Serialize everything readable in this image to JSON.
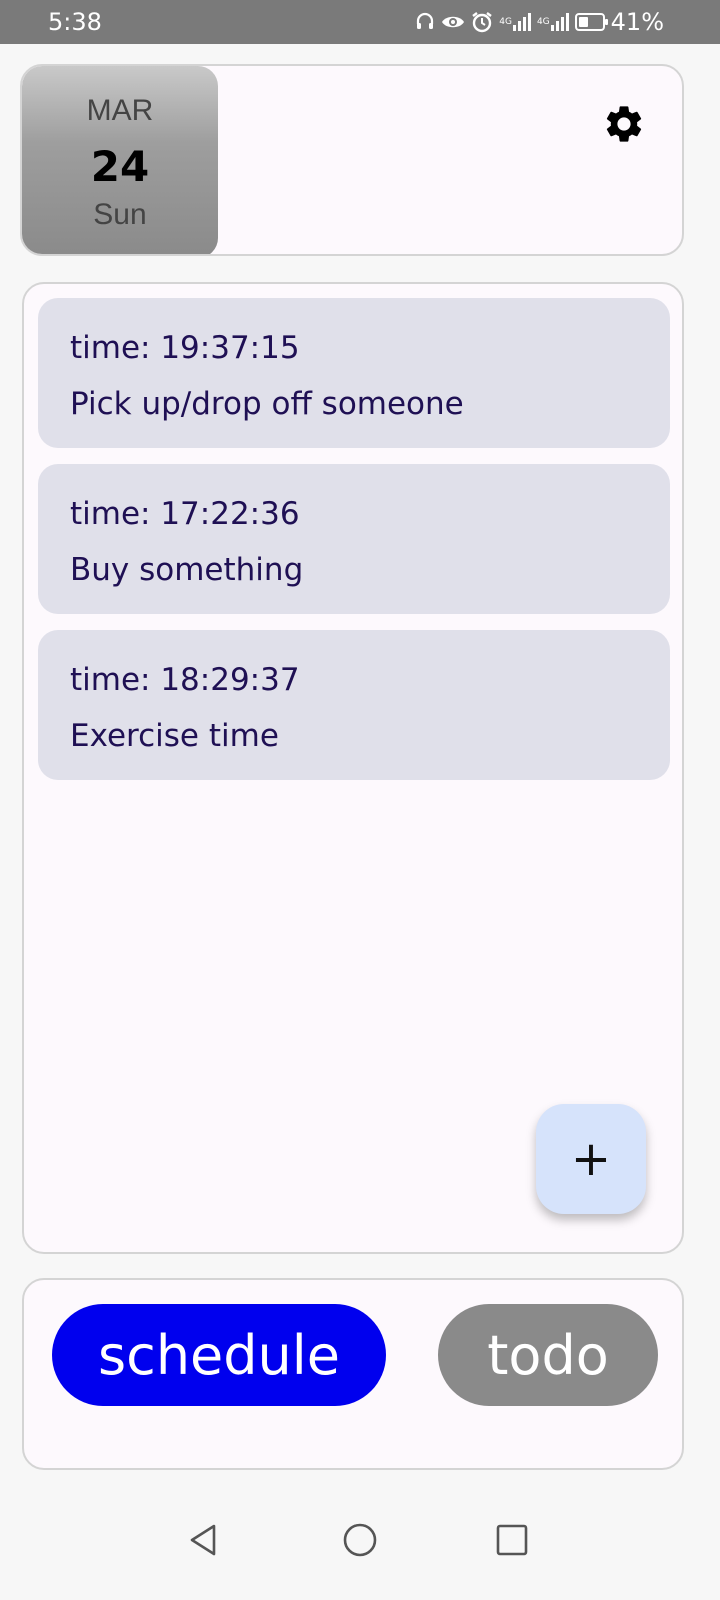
{
  "status_bar": {
    "time": "5:38",
    "icons": [
      "headphones-icon",
      "eye-icon",
      "alarm-icon",
      "signal-4g-icon",
      "signal-4g-icon",
      "battery-icon"
    ],
    "signal_label": "4G",
    "battery_percent": "41%",
    "battery_level": 0.41
  },
  "header": {
    "month": "MAR",
    "day": "24",
    "weekday": "Sun",
    "settings_icon": "gear-icon"
  },
  "schedule_items": [
    {
      "time": "time: 19:37:15",
      "title": "Pick up/drop off someone"
    },
    {
      "time": "time: 17:22:36",
      "title": "Buy something"
    },
    {
      "time": "time: 18:29:37",
      "title": "Exercise time"
    }
  ],
  "fab": {
    "label": "+",
    "icon": "plus-icon"
  },
  "tabs": {
    "schedule_label": "schedule",
    "todo_label": "todo",
    "active": "schedule",
    "active_color": "#0000ee",
    "inactive_color": "#8a8a8a"
  },
  "nav": {
    "icons": [
      "back-icon",
      "home-icon",
      "recents-icon"
    ]
  },
  "colors": {
    "item_background": "#e0e0ea",
    "item_text": "#1f1054",
    "fab_background": "#d6e3fb"
  }
}
